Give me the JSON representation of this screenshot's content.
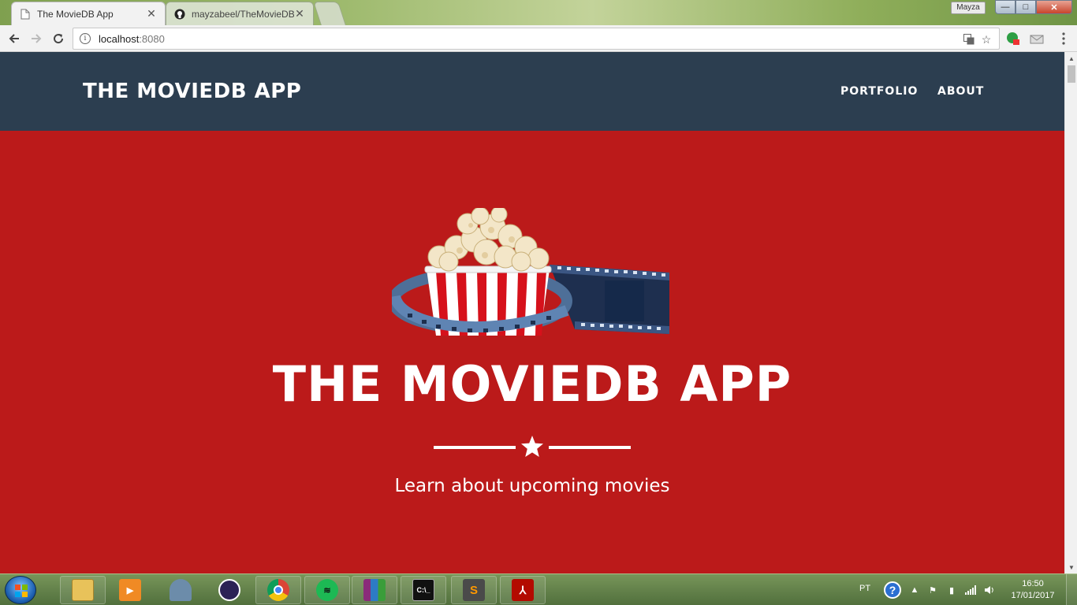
{
  "browser": {
    "tabs": [
      {
        "title": "The MovieDB App",
        "active": true,
        "icon": "page-icon"
      },
      {
        "title": "mayzabeel/TheMovieDB",
        "active": false,
        "icon": "github-icon"
      }
    ],
    "profile_name": "Mayza",
    "url": {
      "host": "localhost",
      "port": ":8080"
    },
    "window_controls": {
      "minimize": "—",
      "maximize": "□",
      "close": "✕"
    }
  },
  "site": {
    "brand": "THE MOVIEDB APP",
    "nav": [
      {
        "label": "PORTFOLIO"
      },
      {
        "label": "ABOUT"
      }
    ],
    "hero": {
      "title": "THE MOVIEDB APP",
      "subtitle": "Learn about upcoming movies",
      "image": "popcorn-filmstrip-illustration"
    }
  },
  "taskbar": {
    "apps": [
      "file-explorer-icon",
      "media-player-icon",
      "connector-icon",
      "eclipse-icon",
      "chrome-icon",
      "spotify-icon",
      "winrar-icon",
      "terminal-icon",
      "sublime-text-icon",
      "acrobat-icon"
    ],
    "language": "PT",
    "time": "16:50",
    "date": "17/01/2017"
  },
  "colors": {
    "nav_bg": "#2c3e50",
    "hero_bg": "#bb1a1a",
    "text": "#ffffff"
  }
}
